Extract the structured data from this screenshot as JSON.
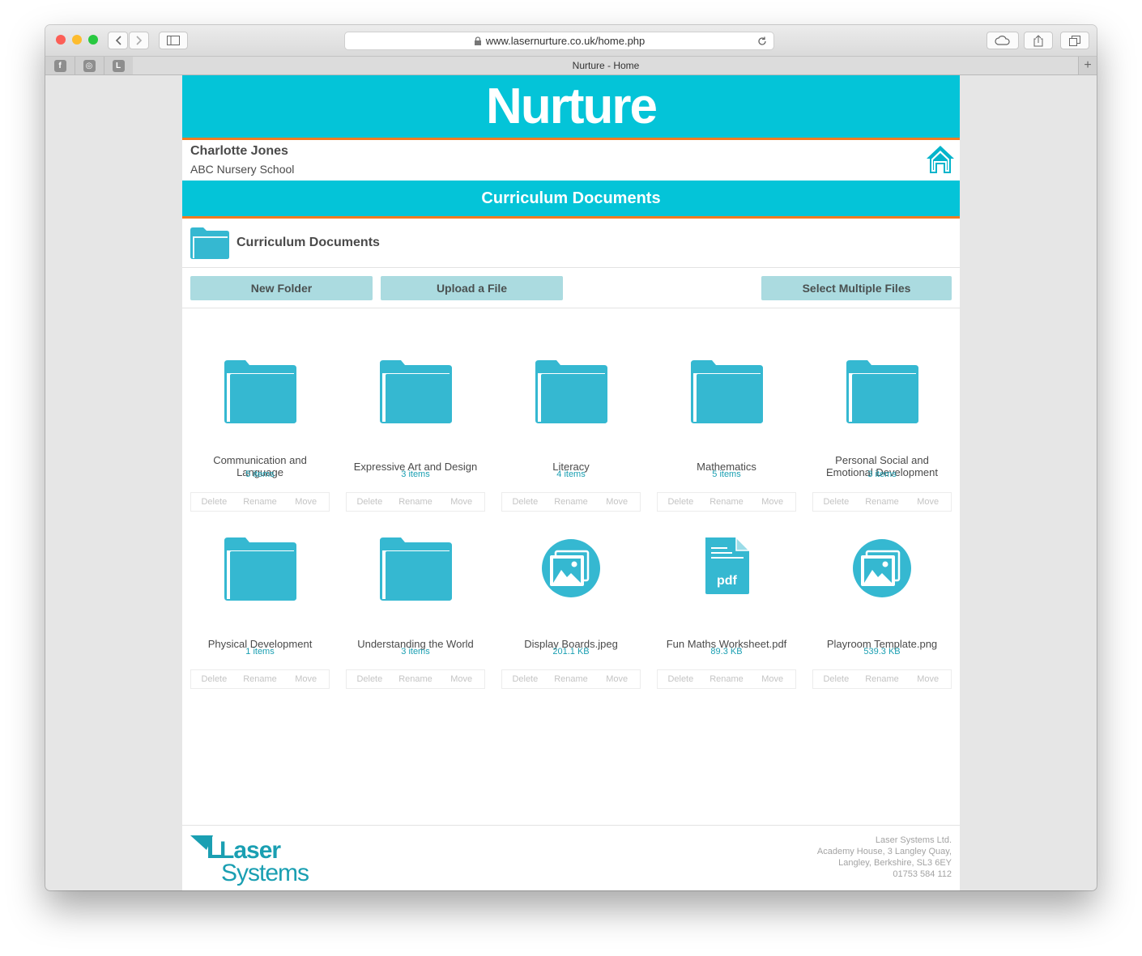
{
  "browser": {
    "url": "www.lasernurture.co.uk/home.php",
    "tab_title": "Nurture - Home",
    "pinned_tabs": [
      "f",
      "◎",
      "L"
    ]
  },
  "banner": {
    "title": "Nurture"
  },
  "user": {
    "name": "Charlotte Jones",
    "school": "ABC Nursery School"
  },
  "section": {
    "title": "Curriculum Documents"
  },
  "breadcrumb": {
    "folder": "Curriculum Documents"
  },
  "actions": {
    "new_folder": "New Folder",
    "upload": "Upload a File",
    "select_multiple": "Select Multiple Files"
  },
  "item_actions": {
    "delete": "Delete",
    "rename": "Rename",
    "move": "Move"
  },
  "items": [
    {
      "name": "Communication and Language",
      "meta": "5 items",
      "icon": "folder-icon"
    },
    {
      "name": "Expressive Art and Design",
      "meta": "3 items",
      "icon": "folder-icon"
    },
    {
      "name": "Literacy",
      "meta": "4 items",
      "icon": "folder-icon"
    },
    {
      "name": "Mathematics",
      "meta": "5 items",
      "icon": "folder-icon"
    },
    {
      "name": "Personal Social and Emotional Development",
      "meta": "3 items",
      "icon": "folder-icon"
    },
    {
      "name": "Physical Development",
      "meta": "1 items",
      "icon": "folder-icon"
    },
    {
      "name": "Understanding the World",
      "meta": "3 items",
      "icon": "folder-icon"
    },
    {
      "name": "Display Boards.jpeg",
      "meta": "201.1 KB",
      "icon": "image-file-icon"
    },
    {
      "name": "Fun Maths Worksheet.pdf",
      "meta": "89.3 KB",
      "icon": "pdf-file-icon"
    },
    {
      "name": "Playroom Template.png",
      "meta": "539.3 KB",
      "icon": "image-file-icon"
    }
  ],
  "footer": {
    "logo_line1": "Laser",
    "logo_line2": "Systems",
    "company": "Laser Systems Ltd.",
    "address1": "Academy House, 3 Langley Quay,",
    "address2": "Langley, Berkshire, SL3 6EY",
    "phone": "01753 584 112"
  },
  "colors": {
    "accent": "#04c4d8",
    "stripe": "#f07b22",
    "icon": "#35b8d1",
    "button": "#abdbe0"
  }
}
